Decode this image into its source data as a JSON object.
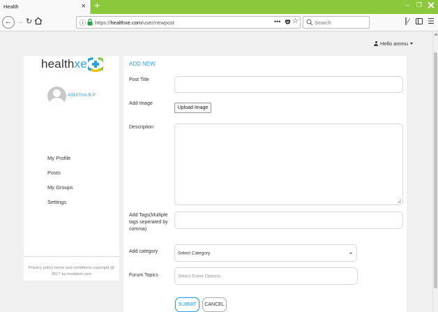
{
  "browser": {
    "tab_title": "Health",
    "tab_close": "×",
    "new_tab": "+",
    "url_prefix": "https://",
    "url_domain": "healthxe.com",
    "url_path": "/user/newpost",
    "page_actions": "•••",
    "search_placeholder": "Search",
    "icons": [
      "back-arrow-icon",
      "forward-arrow-icon",
      "reload-icon",
      "home-icon",
      "info-icon",
      "lock-icon",
      "pocket-icon",
      "bookmark-star-icon",
      "search-icon",
      "library-icon",
      "sidebar-icon",
      "menu-icon"
    ]
  },
  "header": {
    "greeting": "Hello ammu"
  },
  "sidebar": {
    "logo_text_a": "health",
    "logo_text_b": "xe",
    "user_name": "ASHITHA B P",
    "items": [
      {
        "label": "My Profile"
      },
      {
        "label": "Posts"
      },
      {
        "label": "My Groups"
      },
      {
        "label": "Settings"
      }
    ],
    "footer": "Privacy policy terms and conditions copyright @ 2017 by medalert.com"
  },
  "form": {
    "title": "ADD NEW",
    "post_title_label": "Post Title",
    "post_title_value": "",
    "add_image_label": "Add Image",
    "upload_label": "Upload Image",
    "description_label": "Description",
    "description_value": "",
    "tags_label": "Add Tags(Multiple tags seperated by comma)",
    "tags_value": "",
    "category_label": "Add category",
    "category_selected": "Select Category",
    "forum_label": "Forum Topics",
    "forum_placeholder": "Select Some Options",
    "submit_label": "SUBMIT",
    "cancel_label": "CANCEL"
  },
  "colors": {
    "accent": "#29a3e0",
    "titlebar": "#8cc83c",
    "page_bg": "#f0f0f0"
  }
}
